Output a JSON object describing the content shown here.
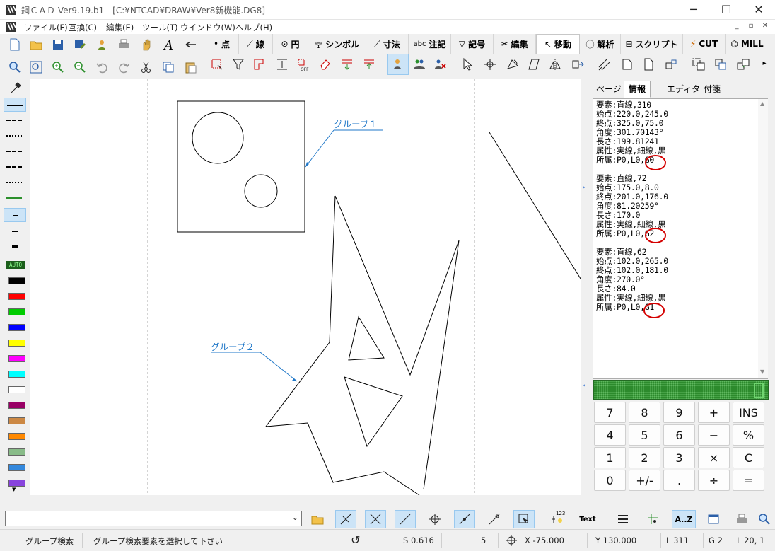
{
  "window": {
    "title": "鋼ＣＡＤ Ver9.19.b1 - [C:¥NTCAD¥DRAW¥Ver8新機能.DG8]",
    "minimize": "─",
    "maximize": "☐",
    "close": "✕"
  },
  "menu": [
    "ファイル(F)",
    "互換(C)",
    "編集(E)",
    "ツール(T)",
    "ウインドウ(W)",
    "ヘルプ(H)"
  ],
  "mdi": {
    "min": "_",
    "restore": "▫",
    "close": "✕"
  },
  "mode_tabs": [
    {
      "icon": "•",
      "label": "点"
    },
    {
      "icon": "⟋",
      "label": "線"
    },
    {
      "icon": "⊙",
      "label": "円"
    },
    {
      "icon": "🝖",
      "label": "シンボル"
    },
    {
      "icon": "⟋",
      "label": "寸法"
    },
    {
      "icon": "abc",
      "label": "注記"
    },
    {
      "icon": "▽",
      "label": "記号"
    },
    {
      "icon": "✂",
      "label": "編集"
    },
    {
      "icon": "↖",
      "label": "移動"
    },
    {
      "icon": "ⓘ",
      "label": "解析"
    },
    {
      "icon": "⊞",
      "label": "スクリプト"
    },
    {
      "icon": "⚡",
      "label": "CUT"
    },
    {
      "icon": "⌬",
      "label": "MILL"
    }
  ],
  "left_toolbar": {
    "auto_label": "AUTO",
    "colors": [
      "#000000",
      "#ff0000",
      "#00cc00",
      "#0000ff",
      "#ffff00",
      "#ff00ff",
      "#00ffff",
      "#ffffff",
      "#990066",
      "#cc8844",
      "#ff8800",
      "#88bb88",
      "#3388dd",
      "#8844dd"
    ]
  },
  "drawing": {
    "label_group1": "グループ１",
    "label_group2": "グループ２",
    "accent": "#1f77c8"
  },
  "side_tabs": [
    "ページ",
    "情報",
    "エディタ",
    "付箋"
  ],
  "info_lines": [
    "要素:直線,310",
    "始点:220.0,245.0",
    "終点:325.0,75.0",
    "角度:301.70143°",
    "長さ:199.81241",
    "属性:実線,細線,黒",
    "所属:P0,L0,G0",
    "要素:直線,72",
    "始点:175.0,8.0",
    "終点:201.0,176.0",
    "角度:81.20259°",
    "長さ:170.0",
    "属性:実線,細線,黒",
    "所属:P0,L0,G2",
    "要素:直線,62",
    "始点:102.0,265.0",
    "終点:102.0,181.0",
    "角度:270.0°",
    "長さ:84.0",
    "属性:実線,細線,黒",
    "所属:P0,L0,G1"
  ],
  "calculator": {
    "display": "0",
    "keys": [
      "7",
      "8",
      "9",
      "+",
      "INS",
      "4",
      "5",
      "6",
      "−",
      "%",
      "1",
      "2",
      "3",
      "×",
      "C",
      "0",
      "+/-",
      ".",
      "÷",
      "="
    ]
  },
  "bottom_toolbar": {
    "text_label": "Text",
    "az_label": "A..Z",
    "num_label": "123"
  },
  "status": {
    "mode": "グループ検索",
    "prompt": "グループ検索要素を選択して下さい",
    "scale": "S 0.616",
    "snap": "5",
    "x": "X  -75.000",
    "y": "Y  130.000",
    "line_no": "L  311",
    "group": "G 2",
    "layer": "L 20, 1"
  }
}
